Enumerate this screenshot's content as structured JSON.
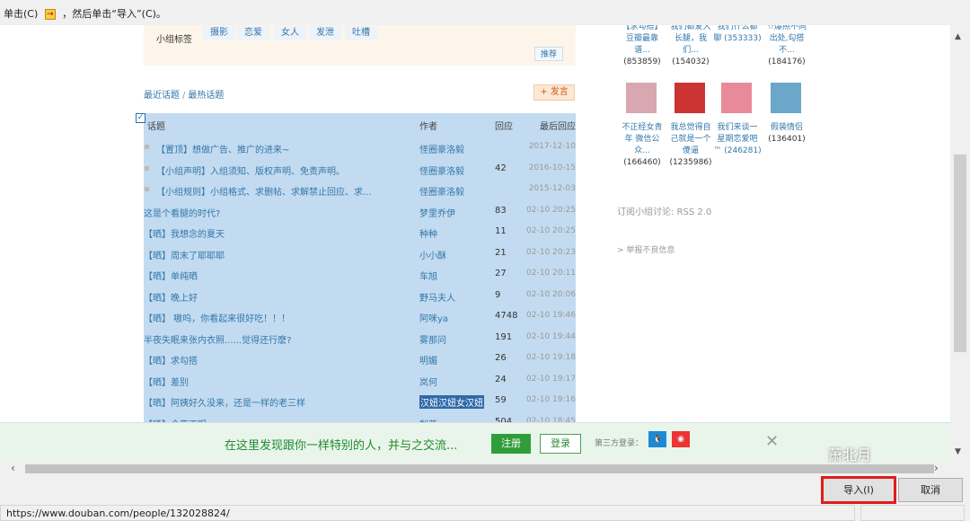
{
  "top_instruction": {
    "prefix": "单击(C)",
    "suffix": "，然后单击“导入”(C)。",
    "icon": "import-icon"
  },
  "group_tags": {
    "label": "小组标签",
    "tags": [
      "摄影",
      "恋爱",
      "女人",
      "发泄",
      "吐槽"
    ],
    "recommend": "推荐"
  },
  "topic_tabs": {
    "recent": "最近话题",
    "separator": "/",
    "hot": "最热话题",
    "post_button": "+ 发言"
  },
  "table": {
    "headers": {
      "title": "话题",
      "author": "作者",
      "replies": "回应",
      "last": "最后回应"
    },
    "rows": [
      {
        "title": "【置顶】想做广告、推广的进来~",
        "author": "怪圈豪洛毅",
        "replies": "",
        "last": "2017-12-10",
        "pinned": true
      },
      {
        "title": "【小组声明】入组须知、版权声明、免责声明。",
        "author": "怪圈豪洛毅",
        "replies": "42",
        "last": "2016-10-15",
        "pinned": true
      },
      {
        "title": "【小组规则】小组格式、求删帖、求解禁止回应、求...",
        "author": "怪圈豪洛毅",
        "replies": "",
        "last": "2015-12-03",
        "pinned": true
      },
      {
        "title": "这是个看腿的时代?",
        "author": "梦里乔伊",
        "replies": "83",
        "last": "02-10 20:25",
        "pinned": false
      },
      {
        "title": "【晒】我想念的夏天",
        "author": "种种",
        "replies": "11",
        "last": "02-10 20:25",
        "pinned": false
      },
      {
        "title": "【晒】周末了耶耶耶",
        "author": "小小酥",
        "replies": "21",
        "last": "02-10 20:23",
        "pinned": false
      },
      {
        "title": "【晒】单纯晒",
        "author": "车旭",
        "replies": "27",
        "last": "02-10 20:11",
        "pinned": false
      },
      {
        "title": "【晒】晚上好",
        "author": "野马夫人",
        "replies": "9",
        "last": "02-10 20:06",
        "pinned": false
      },
      {
        "title": "【晒】 嗷呜，你看起来很好吃！！！",
        "author": "阿咪ya",
        "replies": "4748",
        "last": "02-10 19:46",
        "pinned": false
      },
      {
        "title": "半夜失眠来张内衣照......觉得还行麽?",
        "author": "雾那问",
        "replies": "191",
        "last": "02-10 19:44",
        "pinned": false
      },
      {
        "title": "【晒】求勾搭",
        "author": "明媚",
        "replies": "26",
        "last": "02-10 19:18",
        "pinned": false
      },
      {
        "title": "【晒】差别",
        "author": "岚何",
        "replies": "24",
        "last": "02-10 19:17",
        "pinned": false
      },
      {
        "title": "【晒】阿姨好久没来，还是一样的老三样",
        "author": "汉妞汉妞女汉妞",
        "replies": "59",
        "last": "02-10 19:16",
        "pinned": false,
        "author_selected": true
      },
      {
        "title": "【晒】今夜不眠",
        "author": "梨落",
        "replies": "504",
        "last": "02-10 18:45",
        "pinned": false
      }
    ]
  },
  "related_groups": {
    "row1": [
      {
        "name_lines": [
          "【求勾搭】",
          "豆瓣最靠",
          "谱..."
        ],
        "count": "(853859)"
      },
      {
        "name_lines": [
          "我们都爱大",
          "长腿，我",
          "们..."
        ],
        "count": "(154032)"
      },
      {
        "name_lines": [
          "我们什么都",
          "聊 (353333)"
        ],
        "count": ""
      },
      {
        "name_lines": [
          "☆爆照不同",
          "出处,勾搭",
          "不..."
        ],
        "count": "(184176)"
      }
    ],
    "row2": [
      {
        "name_lines": [
          "不正经女青",
          "年 微信公",
          "众..."
        ],
        "count": "(166460)"
      },
      {
        "name_lines": [
          "我总觉得自",
          "己就是一个",
          "傻逼"
        ],
        "count": "(1235986)"
      },
      {
        "name_lines": [
          "我们来谈一",
          "星期恋爱吧",
          "™ (246281)"
        ],
        "count": ""
      },
      {
        "name_lines": [
          "假装情侣"
        ],
        "count": "(136401)"
      }
    ]
  },
  "rss": "订阅小组讨论: RSS 2.0",
  "report": "> 举报不良信息",
  "banner": {
    "message": "在这里发现跟你一样特别的人，并与之交流...",
    "register": "注册",
    "login": "登录",
    "third_party": "第三方登录：",
    "qq": "QQ",
    "weibo": "微博",
    "close": "✕"
  },
  "dialog": {
    "import_button": "导入(I)",
    "cancel_button": "取消",
    "status_url": "https://www.douban.com/people/132028824/"
  },
  "watermark": "萧北月",
  "colors": {
    "selection": "#c3dbf0",
    "link": "#3377aa",
    "highlight_box": "#e21b1b",
    "register": "#2f9e3a"
  }
}
